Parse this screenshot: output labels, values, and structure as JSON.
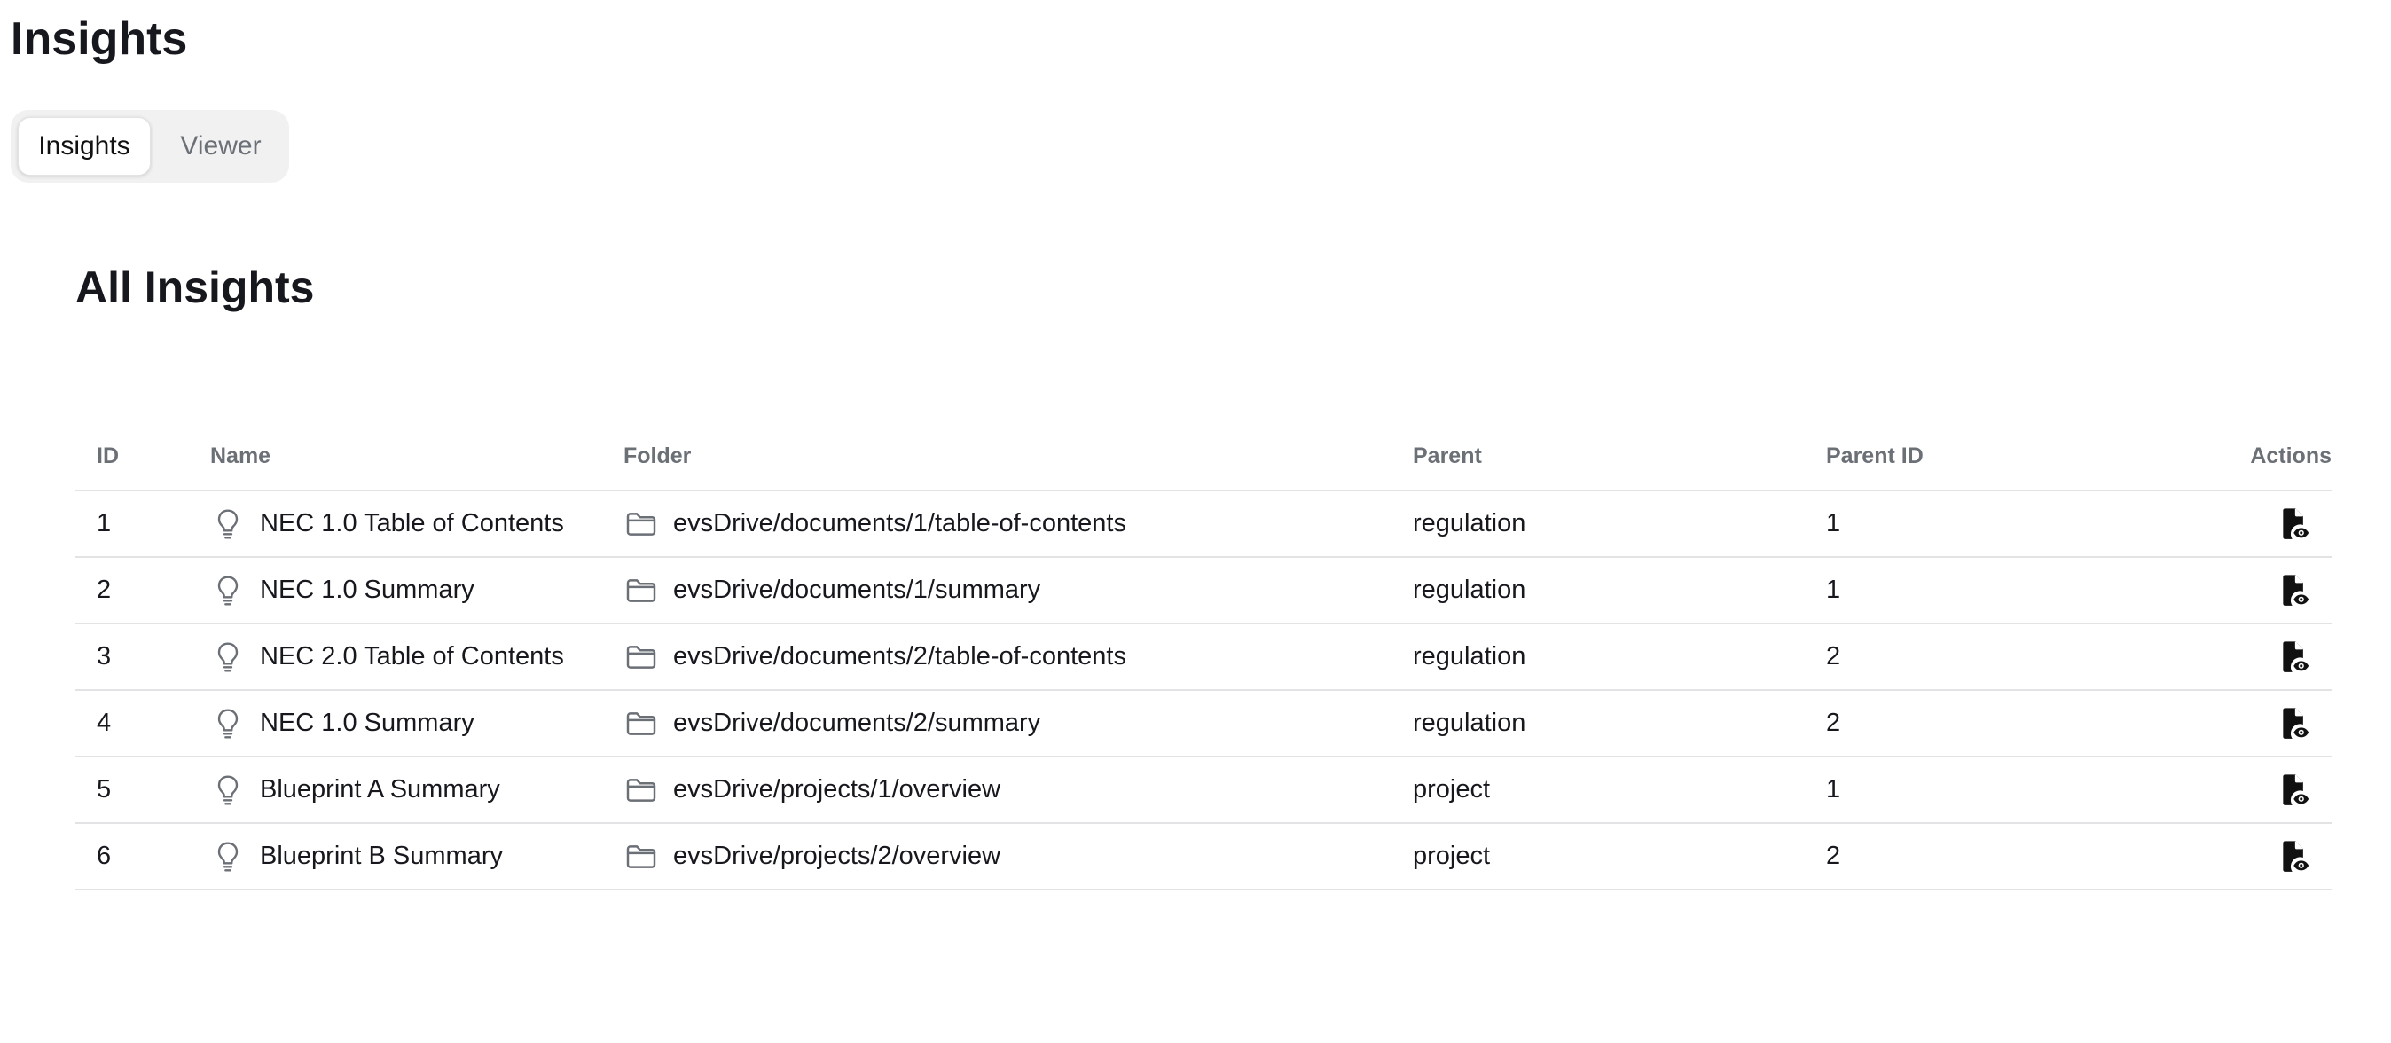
{
  "page": {
    "title": "Insights"
  },
  "tabs": [
    {
      "label": "Insights",
      "active": true
    },
    {
      "label": "Viewer",
      "active": false
    }
  ],
  "section": {
    "title": "All Insights"
  },
  "table": {
    "columns": {
      "id": "ID",
      "name": "Name",
      "folder": "Folder",
      "parent": "Parent",
      "parent_id": "Parent ID",
      "actions": "Actions"
    },
    "rows": [
      {
        "id": "1",
        "name": "NEC 1.0 Table of Contents",
        "folder": "evsDrive/documents/1/table-of-contents",
        "parent": "regulation",
        "parent_id": "1",
        "name_icon": "lightbulb-icon",
        "folder_icon": "folder-icon",
        "action_icon": "view-document-icon"
      },
      {
        "id": "2",
        "name": "NEC 1.0 Summary",
        "folder": "evsDrive/documents/1/summary",
        "parent": "regulation",
        "parent_id": "1",
        "name_icon": "lightbulb-icon",
        "folder_icon": "folder-icon",
        "action_icon": "view-document-icon"
      },
      {
        "id": "3",
        "name": "NEC 2.0 Table of Contents",
        "folder": "evsDrive/documents/2/table-of-contents",
        "parent": "regulation",
        "parent_id": "2",
        "name_icon": "lightbulb-icon",
        "folder_icon": "folder-icon",
        "action_icon": "view-document-icon"
      },
      {
        "id": "4",
        "name": "NEC 1.0 Summary",
        "folder": "evsDrive/documents/2/summary",
        "parent": "regulation",
        "parent_id": "2",
        "name_icon": "lightbulb-icon",
        "folder_icon": "folder-icon",
        "action_icon": "view-document-icon"
      },
      {
        "id": "5",
        "name": "Blueprint A Summary",
        "folder": "evsDrive/projects/1/overview",
        "parent": "project",
        "parent_id": "1",
        "name_icon": "lightbulb-icon",
        "folder_icon": "folder-icon",
        "action_icon": "view-document-icon"
      },
      {
        "id": "6",
        "name": "Blueprint B Summary",
        "folder": "evsDrive/projects/2/overview",
        "parent": "project",
        "parent_id": "2",
        "name_icon": "lightbulb-icon",
        "folder_icon": "folder-icon",
        "action_icon": "view-document-icon"
      }
    ]
  },
  "colors": {
    "text": "#16181d",
    "muted": "#6b6f76",
    "tab_track": "#f1f1f2",
    "divider": "#e3e3e6"
  }
}
